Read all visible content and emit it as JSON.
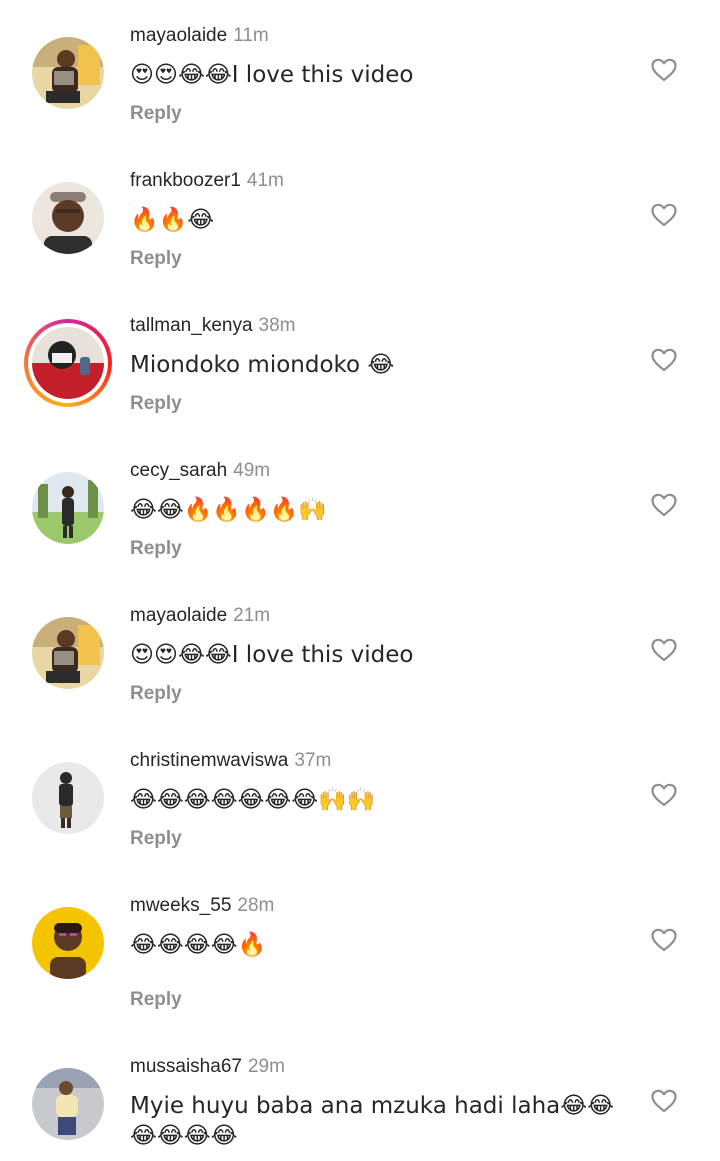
{
  "comments": [
    {
      "username": "mayaolaide",
      "time": "11m",
      "text": "😍😍😂😂I love this video",
      "reply_label": "Reply",
      "like_icon": "heart-outline-icon",
      "avatar_colors": [
        "#e8d7a3",
        "#3a2a1f",
        "#f2c14e"
      ]
    },
    {
      "username": "frankboozer1",
      "time": "41m",
      "text": "🔥🔥😂",
      "reply_label": "Reply",
      "like_icon": "heart-outline-icon",
      "avatar_colors": [
        "#ece6df",
        "#5b3a26",
        "#8a7f74"
      ]
    },
    {
      "username": "tallman_kenya",
      "time": "38m",
      "text": "Miondoko miondoko 😂",
      "reply_label": "Reply",
      "like_icon": "heart-outline-icon",
      "avatar_colors": [
        "#c21f2a",
        "#222222",
        "#e7e1da"
      ],
      "has_story": true
    },
    {
      "username": "cecy_sarah",
      "time": "49m",
      "text": "😂😂🔥🔥🔥🔥🙌",
      "reply_label": "Reply",
      "like_icon": "heart-outline-icon",
      "avatar_colors": [
        "#9cc86c",
        "#2b2b2b",
        "#dfe8ef"
      ]
    },
    {
      "username": "mayaolaide",
      "time": "21m",
      "text": "😍😍😂😂I love this video",
      "reply_label": "Reply",
      "like_icon": "heart-outline-icon",
      "avatar_colors": [
        "#e8d7a3",
        "#3a2a1f",
        "#f2c14e"
      ]
    },
    {
      "username": "christinemwaviswa",
      "time": "37m",
      "text": "😂😂😂😂😂😂😂🙌🙌",
      "reply_label": "Reply",
      "like_icon": "heart-outline-icon",
      "avatar_colors": [
        "#e9e9e9",
        "#2a2a2a",
        "#6b5a3d"
      ]
    },
    {
      "username": "mweeks_55",
      "time": "28m",
      "text": "😂😂😂😂🔥",
      "reply_label": "Reply",
      "like_icon": "heart-outline-icon",
      "avatar_colors": [
        "#f4c400",
        "#5a3a22",
        "#b04aa8"
      ]
    },
    {
      "username": "mussaisha67",
      "time": "29m",
      "text": "Myie huyu baba ana mzuka hadi laha😂😂😂😂😂😂",
      "reply_label": "",
      "like_icon": "heart-outline-icon",
      "avatar_colors": [
        "#c8c8cf",
        "#f3e6b0",
        "#3f4a7a"
      ]
    }
  ]
}
